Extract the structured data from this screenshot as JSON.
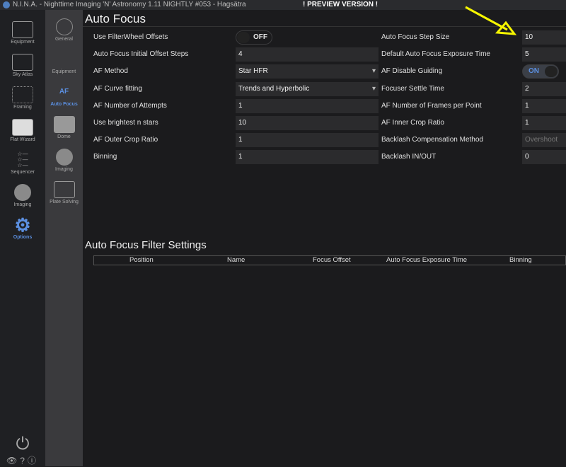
{
  "window": {
    "title": "N.I.N.A. - Nighttime Imaging 'N' Astronomy 1.11 NIGHTLY #053  -  Hagsätra",
    "preview": "! PREVIEW VERSION !"
  },
  "sidebar": {
    "items": [
      {
        "label": "Equipment"
      },
      {
        "label": "Sky Atlas"
      },
      {
        "label": "Framing"
      },
      {
        "label": "Flat Wizard"
      },
      {
        "label": "Sequencer"
      },
      {
        "label": "Imaging"
      },
      {
        "label": "Options",
        "active": true
      }
    ]
  },
  "subnav": {
    "items": [
      {
        "label": "General"
      },
      {
        "label": "Equipment"
      },
      {
        "label": "Auto Focus",
        "icon_text": "AF",
        "active": true
      },
      {
        "label": "Dome"
      },
      {
        "label": "Imaging"
      },
      {
        "label": "Plate Solving"
      }
    ]
  },
  "page": {
    "title": "Auto Focus",
    "filter_title": "Auto Focus Filter Settings"
  },
  "left_settings": [
    {
      "label": "Use FilterWheel Offsets",
      "value": "OFF",
      "type": "toggle"
    },
    {
      "label": "Auto Focus Initial Offset Steps",
      "value": "4"
    },
    {
      "label": "AF Method",
      "value": "Star HFR",
      "type": "dropdown"
    },
    {
      "label": "AF Curve fitting",
      "value": "Trends and Hyperbolic",
      "type": "dropdown"
    },
    {
      "label": "AF Number of Attempts",
      "value": "1"
    },
    {
      "label": "Use brightest n stars",
      "value": "10"
    },
    {
      "label": "AF Outer Crop Ratio",
      "value": "1"
    },
    {
      "label": "Binning",
      "value": "1"
    }
  ],
  "right_settings": [
    {
      "label": "Auto Focus Step Size",
      "value": "10"
    },
    {
      "label": "Default Auto Focus Exposure Time",
      "value": "5"
    },
    {
      "label": "AF Disable Guiding",
      "value": "ON",
      "type": "toggle"
    },
    {
      "label": "Focuser Settle Time",
      "value": "2"
    },
    {
      "label": "AF Number of Frames per Point",
      "value": "1"
    },
    {
      "label": "AF Inner Crop Ratio",
      "value": "1"
    },
    {
      "label": "Backlash Compensation Method",
      "value": "Overshoot",
      "disabled": true
    },
    {
      "label": "Backlash IN/OUT",
      "value": "0"
    }
  ],
  "filter_table": {
    "columns": [
      "Position",
      "Name",
      "Focus Offset",
      "Auto Focus Exposure Time",
      "Binning"
    ]
  },
  "colors": {
    "accent": "#5b8fe0",
    "annotation_arrow": "#f5f500"
  }
}
